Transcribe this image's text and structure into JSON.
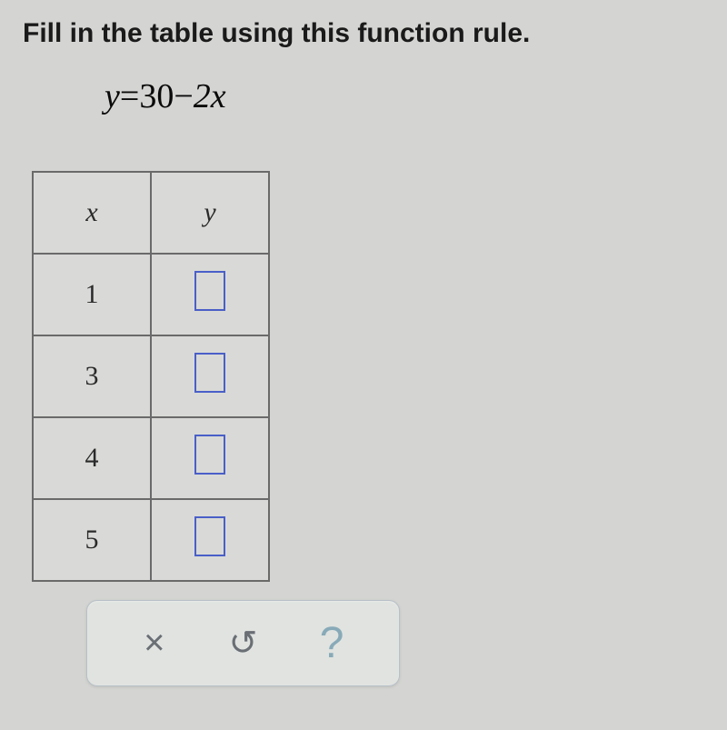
{
  "instruction": "Fill in the table using this function rule.",
  "equation_y": "y",
  "equation_eq": "=",
  "equation_30": "30",
  "equation_minus": "−",
  "equation_2x": "2x",
  "table": {
    "header_x": "x",
    "header_y": "y",
    "rows": [
      {
        "x": "1"
      },
      {
        "x": "3"
      },
      {
        "x": "4"
      },
      {
        "x": "5"
      }
    ]
  },
  "toolbar": {
    "clear": "×",
    "undo": "↺",
    "help": "?"
  }
}
